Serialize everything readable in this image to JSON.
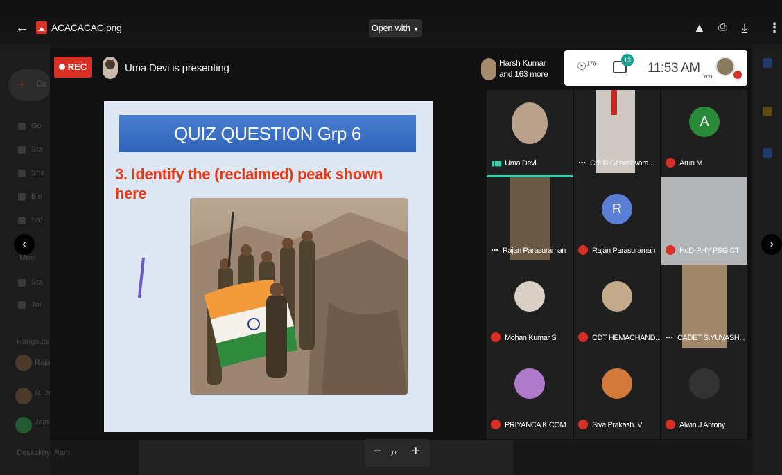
{
  "topbar": {
    "filename": "ACACACAC.png",
    "open_with": "Open with",
    "icons": [
      "back-arrow-icon",
      "add-to-drive-icon",
      "print-icon",
      "download-icon",
      "more-vert-icon"
    ]
  },
  "drive_bg": {
    "new_label": "Co",
    "rows": [
      "Go",
      "Sta",
      "Sha",
      "Bin",
      "Sto"
    ],
    "meet_label": "Meet",
    "meet_rows": [
      "Sta",
      "Joi"
    ],
    "hangouts_label": "Hangouts",
    "hangouts_rows": [
      "Raja",
      "R. Ja",
      "Jain",
      "Deskakhyi Ram"
    ]
  },
  "meeting": {
    "rec_label": "REC",
    "presenting_text": "Uma Devi is presenting",
    "participants_line1": "Harsh Kumar",
    "participants_line2": "and 163 more",
    "people_count": "176",
    "chat_count": "13",
    "time": "11:53 AM",
    "you_label": "You",
    "colors": {
      "rec": "#d93025",
      "speaking": "#2bd8b6",
      "muted": "#d93025"
    }
  },
  "slide": {
    "title": "QUIZ QUESTION Grp 6",
    "question": "3. Identify the (reclaimed) peak shown here"
  },
  "tiles": [
    {
      "name": "Uma Devi",
      "state": "speaking"
    },
    {
      "name": "Cdt R Gireeshvara...",
      "state": "more"
    },
    {
      "name": "Arun M",
      "state": "muted",
      "initial": "A"
    },
    {
      "name": "Rajan Parasuraman",
      "state": "more"
    },
    {
      "name": "Rajan Parasuraman",
      "state": "muted",
      "initial": "R"
    },
    {
      "name": "HoD-PHY PSG CT",
      "state": "muted"
    },
    {
      "name": "Mohan Kumar S",
      "state": "muted"
    },
    {
      "name": "CDT HEMACHAND...",
      "state": "muted"
    },
    {
      "name": "CADET S.YUVASH...",
      "state": "more"
    },
    {
      "name": "PRIYANCA K COM",
      "state": "muted"
    },
    {
      "name": "Siva Prakash. V",
      "state": "muted"
    },
    {
      "name": "Alwin J Antony",
      "state": "muted"
    }
  ],
  "zoom": {
    "minus": "−",
    "zoom_icon": "zoom-icon",
    "plus": "+"
  }
}
